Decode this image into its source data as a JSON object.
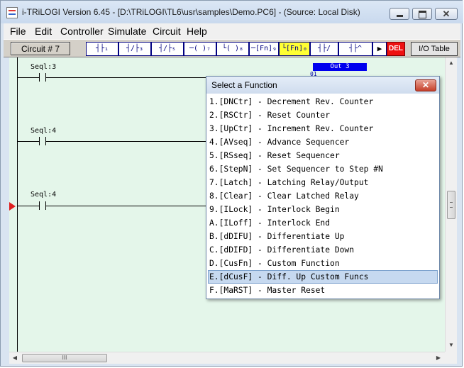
{
  "window": {
    "title": "i-TRiLOGI Version 6.45  - [D:\\TRiLOGI\\TL6\\usr\\samples\\Demo.PC6] - (Source: Local Disk)",
    "close_glyph": "✕"
  },
  "menu": [
    "File",
    "Edit",
    "Controller",
    "Simulate",
    "Circuit",
    "Help"
  ],
  "toolbar": {
    "circuit_label": "Circuit # 7",
    "tools": [
      "┤├₁",
      "┤/├₃",
      "┤/├₅",
      "─( )₇",
      "└( )₈",
      "─[Fn]₉",
      "└[Fn]₀",
      "┤├/",
      "┤├^",
      "▶"
    ],
    "del_label": "DEL",
    "io_table_label": "I/O Table"
  },
  "ladder": {
    "rungs": [
      {
        "label": "Seql:3"
      },
      {
        "label": "Seql:4"
      },
      {
        "label": "Seql:4"
      }
    ],
    "output_label": "Out 3",
    "hidden_text": "01"
  },
  "scrollbar": {
    "h_thumb_grip": "III"
  },
  "dialog": {
    "title": "Select a Function",
    "close_glyph": "✕",
    "items": [
      "1.[DNCtr] - Decrement Rev. Counter",
      "2.[RSCtr] - Reset Counter",
      "3.[UpCtr] - Increment Rev. Counter",
      "4.[AVseq] - Advance Sequencer",
      "5.[RSseq] - Reset Sequencer",
      "6.[StepN] - Set Sequencer to Step #N",
      "7.[Latch] - Latching Relay/Output",
      "8.[Clear] - Clear Latched Relay",
      "9.[ILock] - Interlock Begin",
      "A.[ILoff] - Interlock End",
      "B.[dDIFU] - Differentiate Up",
      "C.[dDIFD] - Differentiate Down",
      "D.[CusFn] - Custom Function",
      "E.[dCusF] - Diff. Up Custom Funcs",
      "F.[MaRST] - Master Reset"
    ],
    "selected_index": 13
  }
}
